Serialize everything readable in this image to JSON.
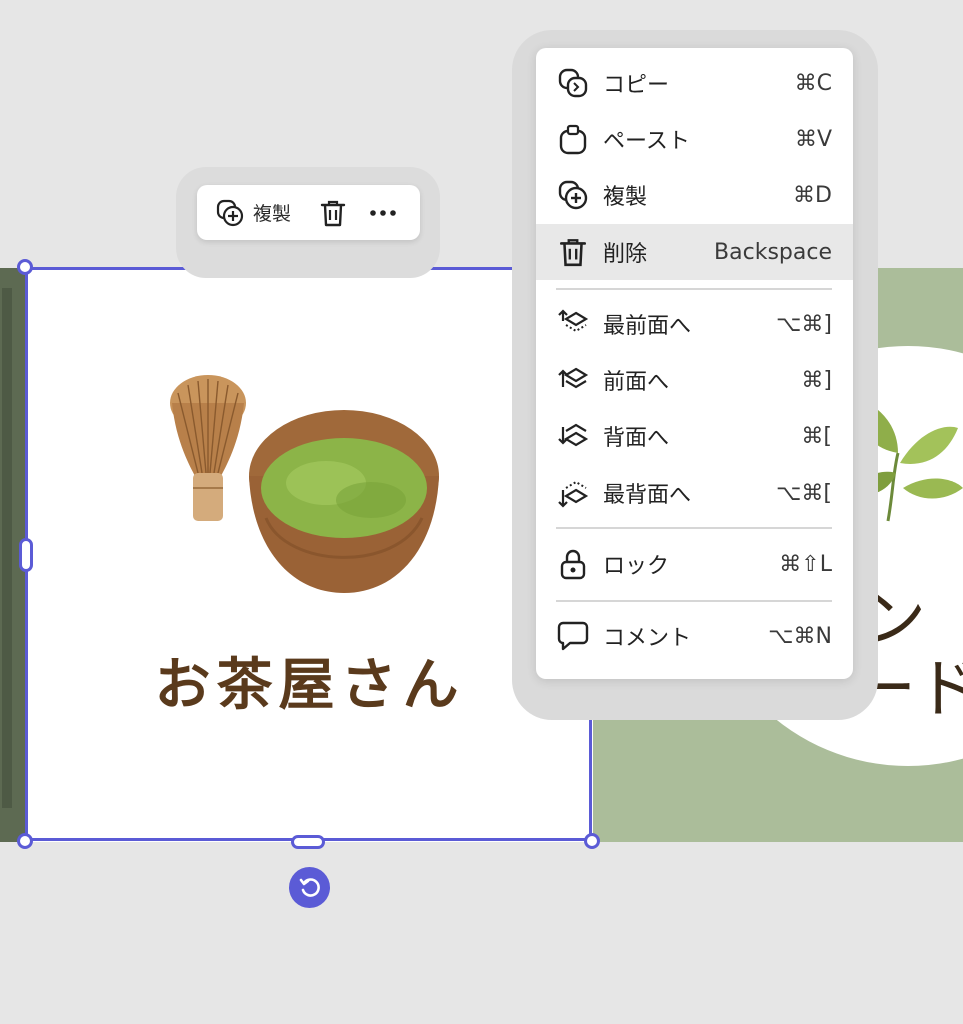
{
  "toolbar": {
    "duplicate_label": "複製"
  },
  "card": {
    "title": "お茶屋さん"
  },
  "right_card": {
    "text_line1": "イン",
    "text_line2": "カード"
  },
  "menu": {
    "items": [
      {
        "label": "コピー",
        "shortcut": "⌘C",
        "icon": "copy-icon"
      },
      {
        "label": "ペースト",
        "shortcut": "⌘V",
        "icon": "paste-icon"
      },
      {
        "label": "複製",
        "shortcut": "⌘D",
        "icon": "duplicate-icon"
      },
      {
        "label": "削除",
        "shortcut": "Backspace",
        "icon": "trash-icon"
      },
      {
        "label": "最前面へ",
        "shortcut": "⌥⌘]",
        "icon": "bring-to-front-icon"
      },
      {
        "label": "前面へ",
        "shortcut": "⌘]",
        "icon": "bring-forward-icon"
      },
      {
        "label": "背面へ",
        "shortcut": "⌘[",
        "icon": "send-backward-icon"
      },
      {
        "label": "最背面へ",
        "shortcut": "⌥⌘[",
        "icon": "send-to-back-icon"
      },
      {
        "label": "ロック",
        "shortcut": "⌘⇧L",
        "icon": "lock-icon"
      },
      {
        "label": "コメント",
        "shortcut": "⌥⌘N",
        "icon": "comment-icon"
      }
    ]
  },
  "colors": {
    "accent": "#5b5bd6",
    "card_green": "#abbd9a",
    "title_brown": "#5a3a1c"
  }
}
